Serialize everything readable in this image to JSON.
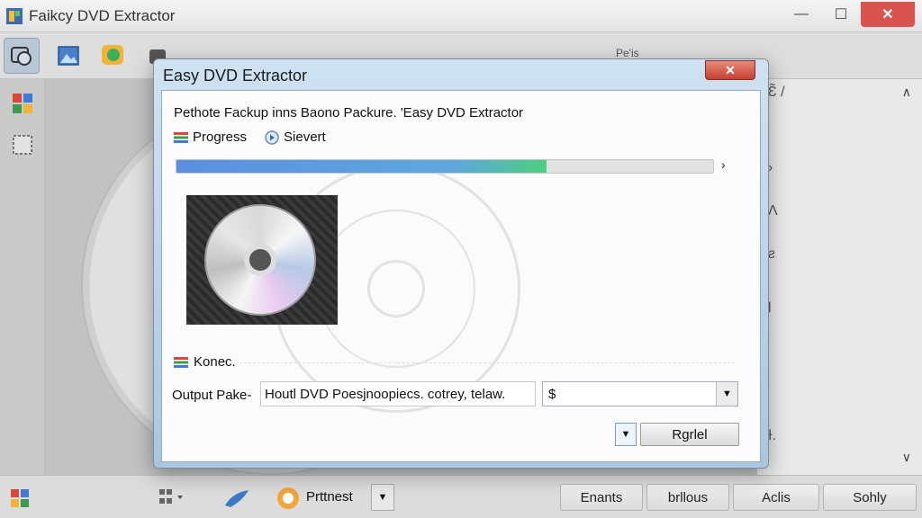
{
  "window": {
    "title": "Faikcy DVD Extractor",
    "toolbar_label": "Pe'is",
    "controls": {
      "minimize": "—",
      "maximize": "☐",
      "close": "✕"
    }
  },
  "right_panel": {
    "items": [
      {
        "glyph": "Ɛ̃ /"
      },
      {
        "glyph": "›"
      },
      {
        "glyph": "Ʌ"
      },
      {
        "glyph": "ƨ"
      },
      {
        "glyph": "Ɩ"
      },
      {
        "glyph": "Ɨ."
      }
    ],
    "chevron_up": "∧",
    "chevron_down": "∨"
  },
  "dialog": {
    "title": "Easy DVD Extractor",
    "close_label": "✕",
    "description": "Pethote Fackup inns Baono Packure. 'Easy DVD Extractor",
    "option_progress": "Progress",
    "option_select": "Sievert",
    "progress": {
      "value": 0.69
    },
    "status_label": "Konec.",
    "output_label": "Output Pake-",
    "output_value": "Houtl DVD Poesjnoopiecs. cotrey, telaw.",
    "format_value": "$",
    "cancel_label": "Rgrlel"
  },
  "bottom_bar": {
    "dropdown_label": "Prttnest",
    "buttons": [
      "Enants",
      "brllous",
      "Aclis",
      "Sohly"
    ]
  },
  "colors": {
    "accent_blue": "#5b8fe0",
    "progress_green": "#4ccf7f",
    "close_red": "#c5402f",
    "dialog_frame": "#a9c6e2"
  }
}
